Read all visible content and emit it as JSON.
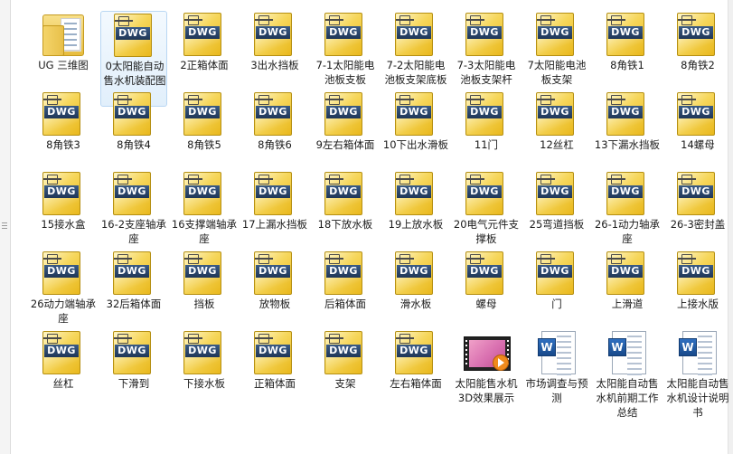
{
  "files": [
    {
      "label": "UG 三维图",
      "icon": "folder-icon",
      "type": "folder"
    },
    {
      "label": "0太阳能自动售水机装配图",
      "icon": "dwg-file-icon",
      "type": "dwg",
      "selected": true
    },
    {
      "label": "2正箱体面",
      "icon": "dwg-file-icon",
      "type": "dwg"
    },
    {
      "label": "3出水挡板",
      "icon": "dwg-file-icon",
      "type": "dwg"
    },
    {
      "label": "7-1太阳能电池板支板",
      "icon": "dwg-file-icon",
      "type": "dwg"
    },
    {
      "label": "7-2太阳能电池板支架底板",
      "icon": "dwg-file-icon",
      "type": "dwg"
    },
    {
      "label": "7-3太阳能电池板支架杆",
      "icon": "dwg-file-icon",
      "type": "dwg"
    },
    {
      "label": "7太阳能电池板支架",
      "icon": "dwg-file-icon",
      "type": "dwg"
    },
    {
      "label": "8角铁1",
      "icon": "dwg-file-icon",
      "type": "dwg"
    },
    {
      "label": "8角铁2",
      "icon": "dwg-file-icon",
      "type": "dwg"
    },
    {
      "label": "8角铁3",
      "icon": "dwg-file-icon",
      "type": "dwg"
    },
    {
      "label": "8角铁4",
      "icon": "dwg-file-icon",
      "type": "dwg"
    },
    {
      "label": "8角铁5",
      "icon": "dwg-file-icon",
      "type": "dwg"
    },
    {
      "label": "8角铁6",
      "icon": "dwg-file-icon",
      "type": "dwg"
    },
    {
      "label": "9左右箱体面",
      "icon": "dwg-file-icon",
      "type": "dwg"
    },
    {
      "label": "10下出水滑板",
      "icon": "dwg-file-icon",
      "type": "dwg"
    },
    {
      "label": "11门",
      "icon": "dwg-file-icon",
      "type": "dwg"
    },
    {
      "label": "12丝杠",
      "icon": "dwg-file-icon",
      "type": "dwg"
    },
    {
      "label": "13下漏水挡板",
      "icon": "dwg-file-icon",
      "type": "dwg"
    },
    {
      "label": "14螺母",
      "icon": "dwg-file-icon",
      "type": "dwg"
    },
    {
      "label": "15接水盒",
      "icon": "dwg-file-icon",
      "type": "dwg"
    },
    {
      "label": "16-2支座轴承座",
      "icon": "dwg-file-icon",
      "type": "dwg"
    },
    {
      "label": "16支撑端轴承座",
      "icon": "dwg-file-icon",
      "type": "dwg"
    },
    {
      "label": "17上漏水挡板",
      "icon": "dwg-file-icon",
      "type": "dwg"
    },
    {
      "label": "18下放水板",
      "icon": "dwg-file-icon",
      "type": "dwg"
    },
    {
      "label": "19上放水板",
      "icon": "dwg-file-icon",
      "type": "dwg"
    },
    {
      "label": "20电气元件支撑板",
      "icon": "dwg-file-icon",
      "type": "dwg"
    },
    {
      "label": "25弯道挡板",
      "icon": "dwg-file-icon",
      "type": "dwg"
    },
    {
      "label": "26-1动力轴承座",
      "icon": "dwg-file-icon",
      "type": "dwg"
    },
    {
      "label": "26-3密封盖",
      "icon": "dwg-file-icon",
      "type": "dwg"
    },
    {
      "label": "26动力端轴承座",
      "icon": "dwg-file-icon",
      "type": "dwg"
    },
    {
      "label": "32后箱体面",
      "icon": "dwg-file-icon",
      "type": "dwg"
    },
    {
      "label": "挡板",
      "icon": "dwg-file-icon",
      "type": "dwg"
    },
    {
      "label": "放物板",
      "icon": "dwg-file-icon",
      "type": "dwg"
    },
    {
      "label": "后箱体面",
      "icon": "dwg-file-icon",
      "type": "dwg"
    },
    {
      "label": "滑水板",
      "icon": "dwg-file-icon",
      "type": "dwg"
    },
    {
      "label": "螺母",
      "icon": "dwg-file-icon",
      "type": "dwg"
    },
    {
      "label": "门",
      "icon": "dwg-file-icon",
      "type": "dwg"
    },
    {
      "label": "上滑道",
      "icon": "dwg-file-icon",
      "type": "dwg"
    },
    {
      "label": "上接水版",
      "icon": "dwg-file-icon",
      "type": "dwg"
    },
    {
      "label": "丝杠",
      "icon": "dwg-file-icon",
      "type": "dwg"
    },
    {
      "label": "下滑到",
      "icon": "dwg-file-icon",
      "type": "dwg"
    },
    {
      "label": "下接水板",
      "icon": "dwg-file-icon",
      "type": "dwg"
    },
    {
      "label": "正箱体面",
      "icon": "dwg-file-icon",
      "type": "dwg"
    },
    {
      "label": "支架",
      "icon": "dwg-file-icon",
      "type": "dwg"
    },
    {
      "label": "左右箱体面",
      "icon": "dwg-file-icon",
      "type": "dwg"
    },
    {
      "label": "太阳能售水机3D效果展示",
      "icon": "video-file-icon",
      "type": "video"
    },
    {
      "label": "市场调查与预测",
      "icon": "word-document-icon",
      "type": "word"
    },
    {
      "label": "太阳能自动售水机前期工作总结",
      "icon": "word-document-icon",
      "type": "word"
    },
    {
      "label": "太阳能自动售水机设计说明书",
      "icon": "word-document-icon",
      "type": "word"
    }
  ],
  "icon_text": {
    "dwg": "DWG",
    "word": "W"
  }
}
